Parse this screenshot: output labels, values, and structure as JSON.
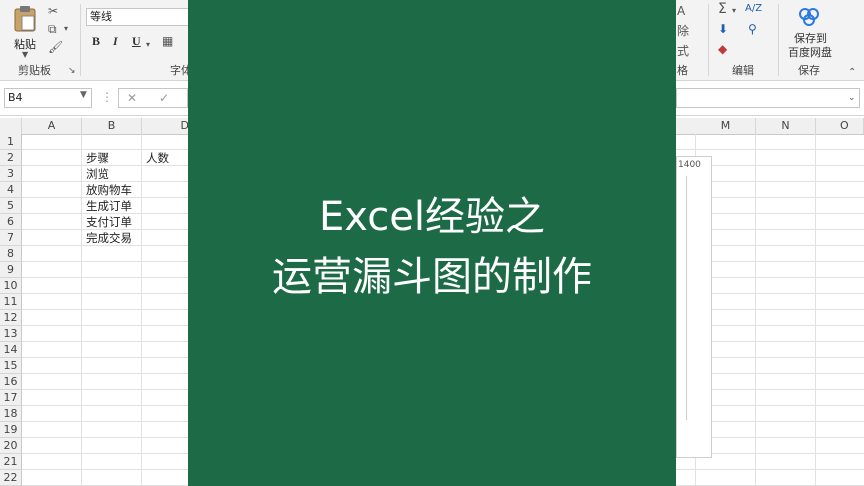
{
  "ribbon": {
    "clipboard": {
      "paste_label": "粘贴",
      "group_label": "剪贴板"
    },
    "font": {
      "font_name": "等线",
      "bold": "B",
      "italic": "I",
      "underline": "U",
      "group_label": "字体"
    },
    "styles": {
      "partial_labels": [
        "A",
        "除",
        "式",
        "格"
      ]
    },
    "editing": {
      "group_label": "编辑",
      "sum": "Σ",
      "sort": "A/Z",
      "find": "⚲"
    },
    "save": {
      "button_label_line1": "保存到",
      "button_label_line2": "百度网盘",
      "group_label": "保存"
    }
  },
  "formula_bar": {
    "name_box": "B4",
    "cancel": "✕",
    "enter": "✓",
    "more": "⋮",
    "formula_value": ""
  },
  "sheet": {
    "columns": [
      "A",
      "B",
      "D",
      "M",
      "N",
      "O"
    ],
    "rows": [
      "1",
      "2",
      "3",
      "4",
      "5",
      "6",
      "7",
      "8",
      "9",
      "10",
      "11",
      "12",
      "13",
      "14",
      "15",
      "16",
      "17",
      "18",
      "19",
      "20",
      "21",
      "22"
    ],
    "cells": {
      "B2": "步骤",
      "C2": "人数",
      "B3": "浏览",
      "B4": "放购物车",
      "B5": "生成订单",
      "B6": "支付订单",
      "B7": "完成交易"
    }
  },
  "chart": {
    "tick_label": "1400"
  },
  "overlay": {
    "title_line1": "Excel经验之",
    "title_line2": "运营漏斗图的制作",
    "background_color": "#1c6b46"
  }
}
